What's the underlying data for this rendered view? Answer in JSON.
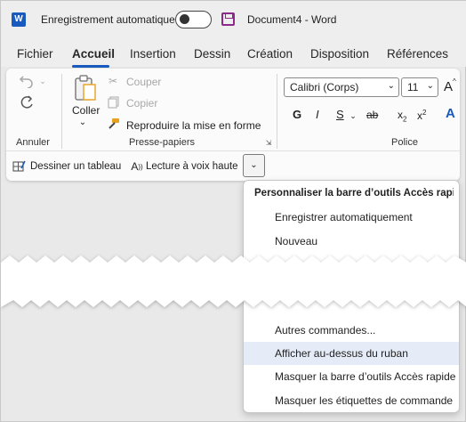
{
  "titlebar": {
    "autosave_label": "Enregistrement automatique",
    "doc_title": "Document4  -  Word"
  },
  "tabs": [
    {
      "label": "Fichier"
    },
    {
      "label": "Accueil",
      "active": true
    },
    {
      "label": "Insertion"
    },
    {
      "label": "Dessin"
    },
    {
      "label": "Création"
    },
    {
      "label": "Disposition"
    },
    {
      "label": "Références"
    }
  ],
  "ribbon": {
    "undo_group": "Annuler",
    "clipboard": {
      "paste": "Coller",
      "cut": "Couper",
      "copy": "Copier",
      "format_painter": "Reproduire la mise en forme",
      "group": "Presse-papiers"
    },
    "font": {
      "name": "Calibri (Corps)",
      "size": "11",
      "group": "Police",
      "bold": "G",
      "italic": "I",
      "underline": "S",
      "strike": "ab",
      "subscript": "x",
      "subscript_mark": "2",
      "superscript": "x",
      "superscript_mark": "2",
      "grow": "A",
      "effects": "A"
    }
  },
  "qat": {
    "draw_table": "Dessiner un tableau",
    "read_aloud": "Lecture à voix haute"
  },
  "menu": {
    "header": "Personnaliser la barre d’outils Accès rapide",
    "items_top": [
      {
        "label": "Enregistrer automatiquement"
      },
      {
        "label": "Nouveau"
      }
    ],
    "items_bottom": [
      {
        "label": "Autres commandes..."
      },
      {
        "label": "Afficher au-dessus du ruban",
        "highlighted": true
      },
      {
        "label": "Masquer la barre d’outils Accès rapide"
      },
      {
        "label": "Masquer les étiquettes de commande"
      }
    ]
  },
  "colors": {
    "accent": "#185abd",
    "highlight": "#e5ecf7",
    "save_icon": "#8c2a8c"
  }
}
